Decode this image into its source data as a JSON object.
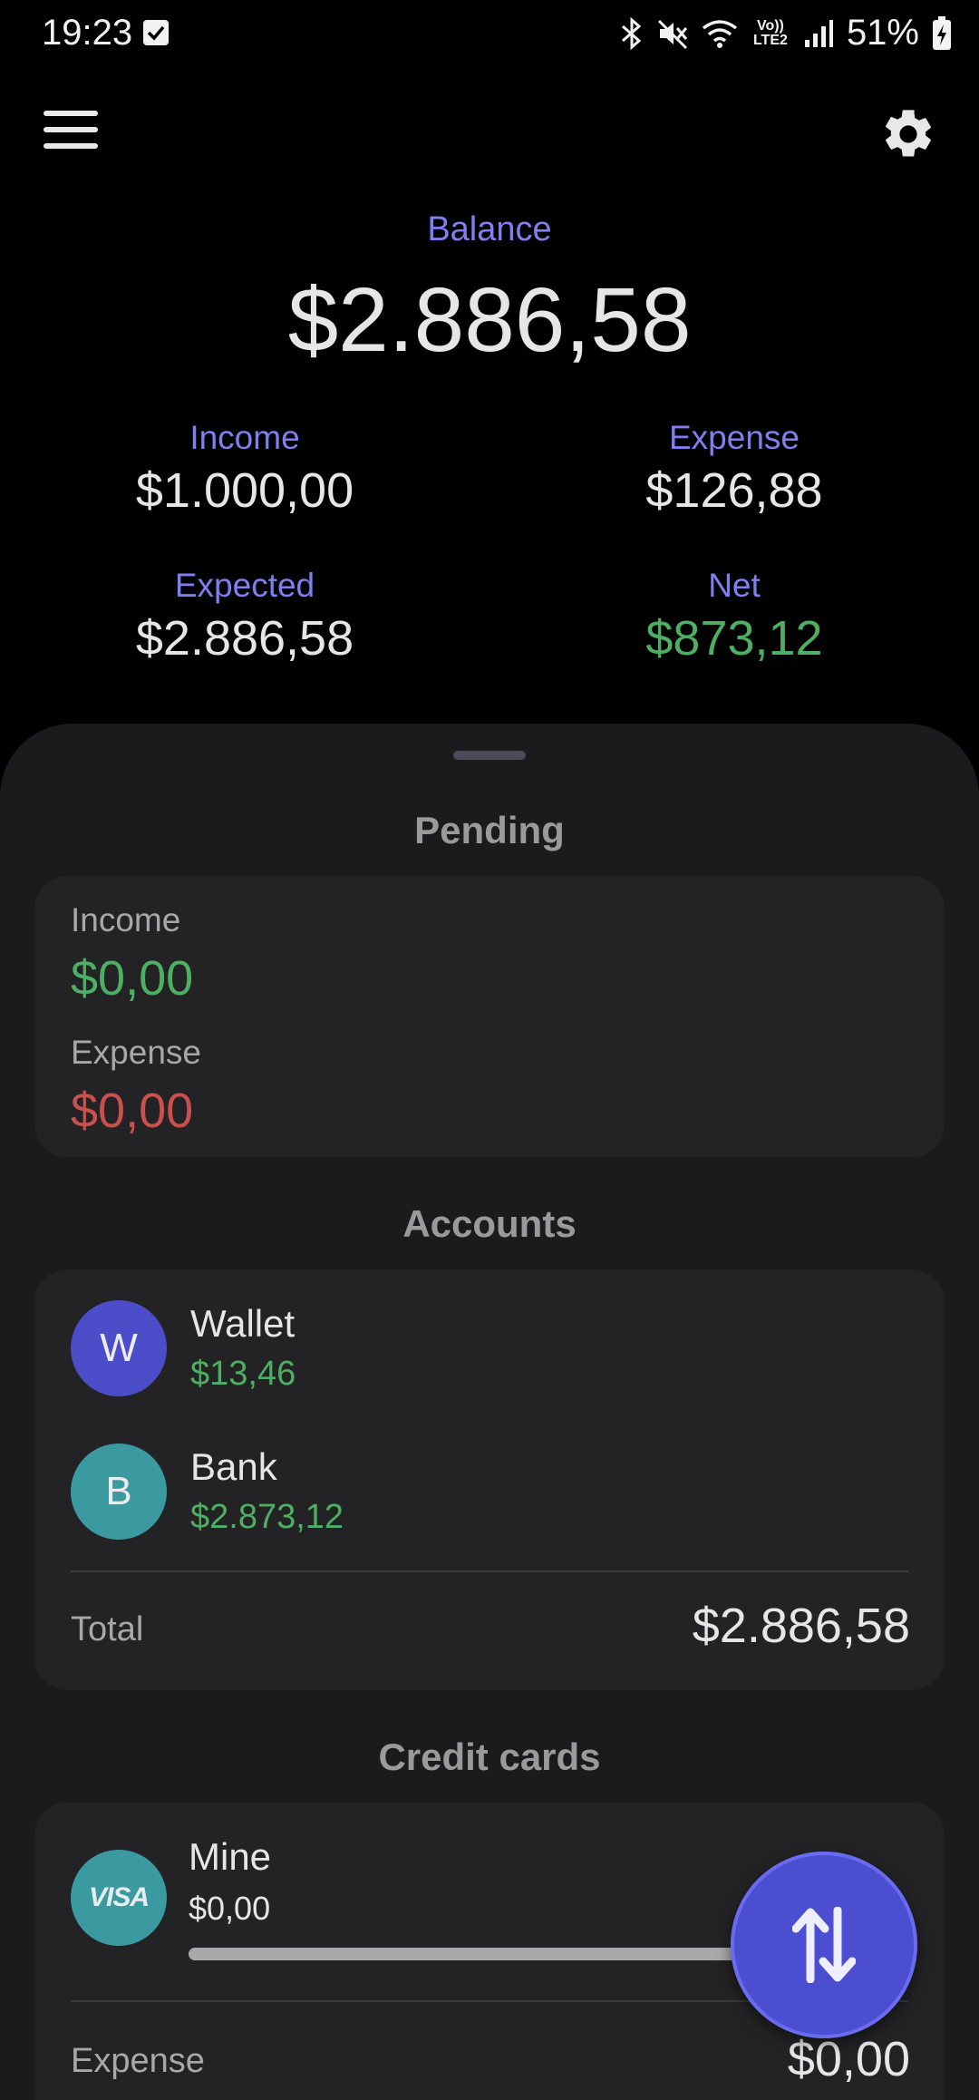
{
  "status_bar": {
    "time": "19:23",
    "battery": "51%",
    "network_label": "Vo)) LTE2",
    "icons": [
      "checkbox-notification-icon",
      "bluetooth-icon",
      "mute-icon",
      "wifi-icon",
      "signal-icon",
      "battery-charging-icon"
    ]
  },
  "top_bar": {
    "menu_icon": "hamburger-menu-icon",
    "settings_icon": "gear-icon"
  },
  "summary": {
    "balance_label": "Balance",
    "balance_value": "$2.886,58",
    "income_label": "Income",
    "income_value": "$1.000,00",
    "expense_label": "Expense",
    "expense_value": "$126,88",
    "expected_label": "Expected",
    "expected_value": "$2.886,58",
    "net_label": "Net",
    "net_value": "$873,12"
  },
  "pending": {
    "title": "Pending",
    "income_label": "Income",
    "income_value": "$0,00",
    "expense_label": "Expense",
    "expense_value": "$0,00"
  },
  "accounts": {
    "title": "Accounts",
    "items": [
      {
        "initial": "W",
        "name": "Wallet",
        "balance": "$13,46",
        "color": "#4b4ec8"
      },
      {
        "initial": "B",
        "name": "Bank",
        "balance": "$2.873,12",
        "color": "#3a9aa0"
      }
    ],
    "total_label": "Total",
    "total_value": "$2.886,58"
  },
  "credit_cards": {
    "title": "Credit cards",
    "items": [
      {
        "logo": "VISA",
        "name": "Mine",
        "used": "$0,00",
        "limit_partial": "$",
        "usage_fraction": 0.0,
        "color": "#3a9aa0"
      }
    ],
    "expense_label": "Expense",
    "expense_value": "$0,00"
  },
  "fab": {
    "icon": "swap-vertical-arrows-icon"
  },
  "colors": {
    "accent_label": "#7f7ff0",
    "positive": "#4caf61",
    "negative": "#c9504c",
    "fab": "#4b4ed1"
  }
}
